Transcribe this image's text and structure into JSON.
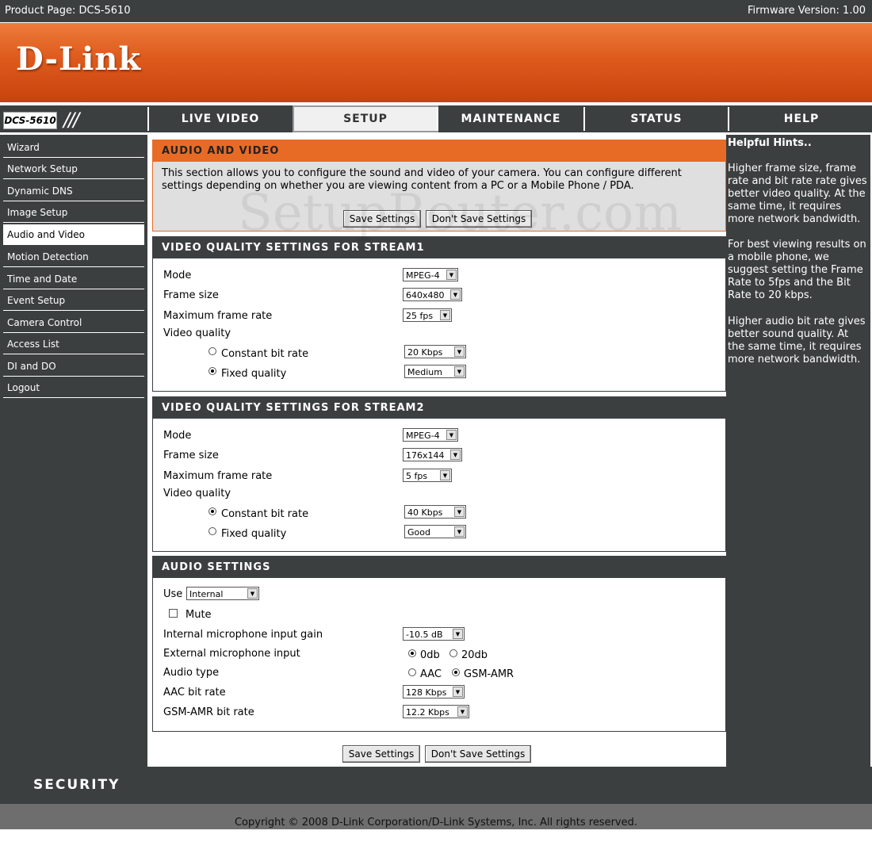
{
  "topbar": {
    "product": "Product Page: DCS-5610",
    "firmware": "Firmware Version: 1.00"
  },
  "brand": {
    "logo": "D-Link",
    "model": "DCS-5610",
    "slashes": "///"
  },
  "tabs": [
    {
      "label": "LIVE VIDEO"
    },
    {
      "label": "SETUP"
    },
    {
      "label": "MAINTENANCE"
    },
    {
      "label": "STATUS"
    },
    {
      "label": "HELP"
    }
  ],
  "sidebar": {
    "items": [
      {
        "label": "Wizard"
      },
      {
        "label": "Network Setup"
      },
      {
        "label": "Dynamic DNS"
      },
      {
        "label": "Image Setup"
      },
      {
        "label": "Audio and Video"
      },
      {
        "label": "Motion Detection"
      },
      {
        "label": "Time and Date"
      },
      {
        "label": "Event Setup"
      },
      {
        "label": "Camera Control"
      },
      {
        "label": "Access List"
      },
      {
        "label": "DI and DO"
      },
      {
        "label": "Logout"
      }
    ]
  },
  "intro": {
    "title": "AUDIO AND VIDEO",
    "text": "This section allows you to configure the sound and video of your camera. You can configure different settings depending on whether you are viewing content from a PC or a Mobile Phone / PDA.",
    "save": "Save Settings",
    "dont_save": "Don't Save Settings"
  },
  "stream1": {
    "title": "VIDEO QUALITY SETTINGS FOR STREAM1",
    "mode_label": "Mode",
    "mode": "MPEG-4",
    "frame_size_label": "Frame size",
    "frame_size": "640x480",
    "max_fps_label": "Maximum frame rate",
    "max_fps": "25 fps",
    "quality_label": "Video quality",
    "cbr_label": "Constant bit rate",
    "cbr": "20 Kbps",
    "fixed_label": "Fixed quality",
    "fixed": "Medium"
  },
  "stream2": {
    "title": "VIDEO QUALITY SETTINGS FOR STREAM2",
    "mode_label": "Mode",
    "mode": "MPEG-4",
    "frame_size_label": "Frame size",
    "frame_size": "176x144",
    "max_fps_label": "Maximum frame rate",
    "max_fps": "5 fps",
    "quality_label": "Video quality",
    "cbr_label": "Constant bit rate",
    "cbr": "40 Kbps",
    "fixed_label": "Fixed quality",
    "fixed": "Good"
  },
  "audio": {
    "title": "AUDIO SETTINGS",
    "use_label": "Use",
    "use": "Internal",
    "mute_label": "Mute",
    "int_gain_label": "Internal microphone input gain",
    "int_gain": "-10.5 dB",
    "ext_input_label": "External microphone input",
    "ext_0db": "0db",
    "ext_20db": "20db",
    "type_label": "Audio type",
    "type_aac": "AAC",
    "type_gsm": "GSM-AMR",
    "aac_label": "AAC bit rate",
    "aac": "128 Kbps",
    "gsm_label": "GSM-AMR bit rate",
    "gsm": "12.2 Kbps"
  },
  "bottom": {
    "save": "Save Settings",
    "dont_save": "Don't Save Settings"
  },
  "hints": {
    "title": "Helpful Hints..",
    "p1": "Higher frame size, frame rate and bit rate rate gives better video quality. At the same time, it requires more network bandwidth.",
    "p2": "For best viewing results on a mobile phone, we suggest setting the Frame Rate to 5fps and the Bit Rate to 20 kbps.",
    "p3": "Higher audio bit rate gives better sound quality. At the same time, it requires more network bandwidth."
  },
  "footer": {
    "security": "SECURITY",
    "copyright": "Copyright © 2008 D-Link Corporation/D-Link Systems, Inc. All rights reserved."
  },
  "watermark": "SetupRouter.com"
}
